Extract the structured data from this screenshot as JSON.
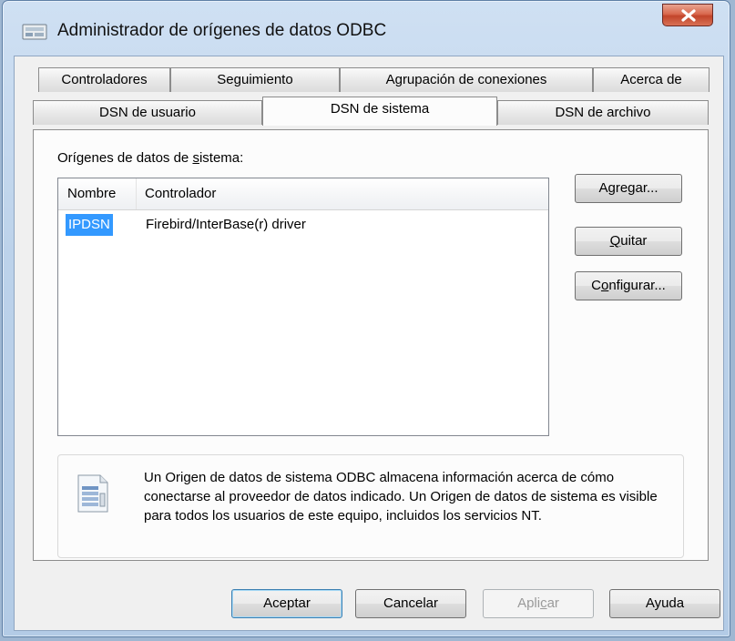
{
  "window": {
    "title": "Administrador de orígenes de datos ODBC",
    "close_symbol": "X"
  },
  "tabs": {
    "top_row": [
      "Controladores",
      "Seguimiento",
      "Agrupación de conexiones",
      "Acerca de"
    ],
    "bottom_row": [
      "DSN de usuario",
      "DSN de sistema",
      "DSN de archivo"
    ],
    "active": "DSN de sistema"
  },
  "panel": {
    "section_label_pre": "Orígenes de datos de ",
    "section_label_acc": "s",
    "section_label_post": "istema:",
    "columns": [
      "Nombre",
      "Controlador"
    ],
    "rows": [
      {
        "name": "IPDSN",
        "driver": "Firebird/InterBase(r) driver"
      }
    ],
    "buttons": {
      "add": {
        "pre": "A",
        "acc": "g",
        "post": "regar..."
      },
      "remove": {
        "pre": "",
        "acc": "Q",
        "post": "uitar"
      },
      "configure": {
        "pre": "C",
        "acc": "o",
        "post": "nfigurar..."
      }
    },
    "info_text": "Un Origen de datos de sistema ODBC almacena información acerca de cómo conectarse al proveedor de datos indicado. Un Origen de datos de sistema es visible para todos los usuarios de este equipo, incluidos los servicios NT."
  },
  "footer": {
    "ok": "Aceptar",
    "cancel": "Cancelar",
    "apply_pre": "Apli",
    "apply_acc": "c",
    "apply_post": "ar",
    "help": "Ayuda"
  },
  "icons": {
    "app": "odbc-administrator-icon",
    "info": "data-source-document-icon",
    "close": "close-icon"
  }
}
